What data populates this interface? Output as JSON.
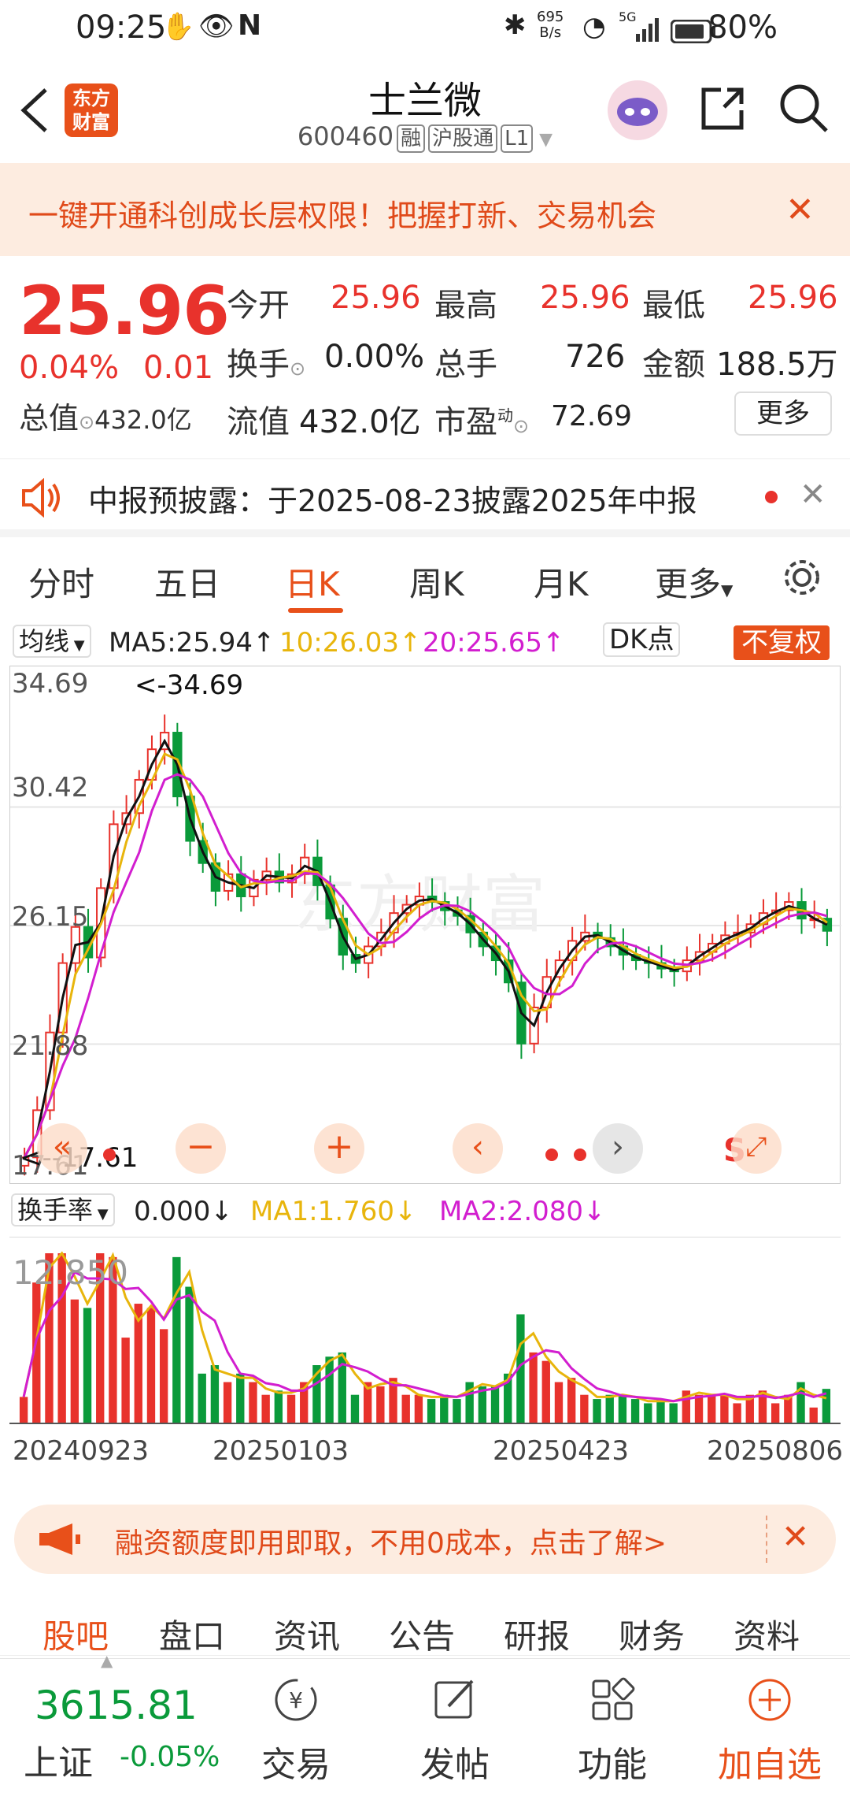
{
  "status_bar": {
    "time": "09:25",
    "net_speed_value": "695",
    "net_speed_unit": "B/s",
    "signal": "5G",
    "battery": "80%"
  },
  "nav": {
    "title": "士兰微",
    "code": "600460",
    "tags": [
      "融",
      "沪股通",
      "L1"
    ],
    "logo_text_1": "东方",
    "logo_text_2": "财富"
  },
  "banner": {
    "text": "一键开通科创成长层权限！把握打新、交易机会"
  },
  "quote": {
    "price": "25.96",
    "change_pct": "0.04%",
    "change": "0.01",
    "open_label": "今开",
    "open": "25.96",
    "high_label": "最高",
    "high": "25.96",
    "low_label": "最低",
    "low": "25.96",
    "turnover_label": "换手",
    "turnover": "0.00%",
    "volume_label": "总手",
    "volume": "726",
    "amount_label": "金额",
    "amount": "188.5万",
    "mktcap_label": "总值",
    "mktcap": "432.0亿",
    "float_label": "流值",
    "float": "432.0亿",
    "pe_label": "市盈",
    "pe_sup": "动",
    "pe": "72.69",
    "more_label": "更多"
  },
  "notice": {
    "text": "中报预披露：于2025-08-23披露2025年中报"
  },
  "tabs": [
    {
      "label": "分时"
    },
    {
      "label": "五日"
    },
    {
      "label": "日K"
    },
    {
      "label": "周K"
    },
    {
      "label": "月K"
    },
    {
      "label": "更多"
    }
  ],
  "ma_legend": {
    "selector": "均线",
    "ma5": "MA5:25.94↑",
    "ma10": "10:26.03↑",
    "ma20": "20:25.65↑",
    "dk": "DK点",
    "adjust": "不复权"
  },
  "chart_data": {
    "type": "candlestick",
    "y_ticks": [
      "34.69",
      "30.42",
      "26.15",
      "21.88",
      "17.61"
    ],
    "max_marker": "<-34.69",
    "min_marker": "<--17.61",
    "ylim": [
      17.61,
      34.69
    ],
    "x_labels": [
      "20240923",
      "20250103",
      "20250423",
      "20250806"
    ],
    "watermark": "东方财富",
    "close_series": [
      17.8,
      19.5,
      22.3,
      24.8,
      26.1,
      25.0,
      27.5,
      29.8,
      30.2,
      31.4,
      32.5,
      33.1,
      30.8,
      29.2,
      28.4,
      27.4,
      28.0,
      27.2,
      27.8,
      28.1,
      27.7,
      28.0,
      28.6,
      27.6,
      26.4,
      25.1,
      24.8,
      25.4,
      25.9,
      26.6,
      26.9,
      27.2,
      27.0,
      26.7,
      26.5,
      25.9,
      25.4,
      24.9,
      24.1,
      21.9,
      23.2,
      24.3,
      24.9,
      25.6,
      25.9,
      25.7,
      25.4,
      25.1,
      24.9,
      24.8,
      24.6,
      24.5,
      24.9,
      25.2,
      25.5,
      25.8,
      25.9,
      26.2,
      26.6,
      26.7,
      27.0,
      26.4,
      26.4,
      25.96
    ]
  },
  "vol_legend": {
    "selector": "换手率",
    "value": "0.000↓",
    "ma1": "MA1:1.760↓",
    "ma2": "MA2:2.080↓",
    "max_tick": "12.850"
  },
  "promo": {
    "text": "融资额度即用即取，不用0成本，点击了解>"
  },
  "sub_tabs": [
    {
      "label": "股吧"
    },
    {
      "label": "盘口"
    },
    {
      "label": "资讯"
    },
    {
      "label": "公告"
    },
    {
      "label": "研报"
    },
    {
      "label": "财务"
    },
    {
      "label": "资料"
    }
  ],
  "toolbar": {
    "index_value": "3615.81",
    "index_name": "上证",
    "index_change": "-0.05%",
    "items": [
      {
        "label": "交易"
      },
      {
        "label": "发帖"
      },
      {
        "label": "功能"
      },
      {
        "label": "加自选"
      }
    ]
  }
}
